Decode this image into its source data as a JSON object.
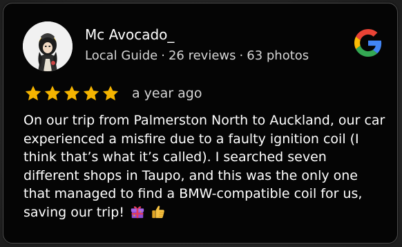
{
  "reviewer": {
    "name": "Mc Avocado_",
    "badge": "Local Guide",
    "reviews": "26 reviews",
    "photos": "63 photos",
    "separator": "·"
  },
  "rating": {
    "stars": 5,
    "max_stars": 5,
    "star_color": "#f5b400",
    "time": "a year ago"
  },
  "review": {
    "text": "On our trip from Palmerston North to Auckland, our car experienced a misfire due to a faulty ignition coil (I think that’s what it’s called). I searched seven different shops in Taupo, and this was the only one that managed to find a BMW-compatible coil for us, saving our trip!",
    "emojis": [
      "gift-emoji",
      "thumbs-up-emoji"
    ]
  },
  "brand": {
    "icon": "google-logo-icon",
    "colors": [
      "#4285f4",
      "#ea4335",
      "#fbbc05",
      "#34a853"
    ]
  },
  "colors": {
    "card_background": "#050505",
    "card_border": "#4a4a4a",
    "text_primary": "#ffffff",
    "text_secondary": "#d6d6d6"
  }
}
